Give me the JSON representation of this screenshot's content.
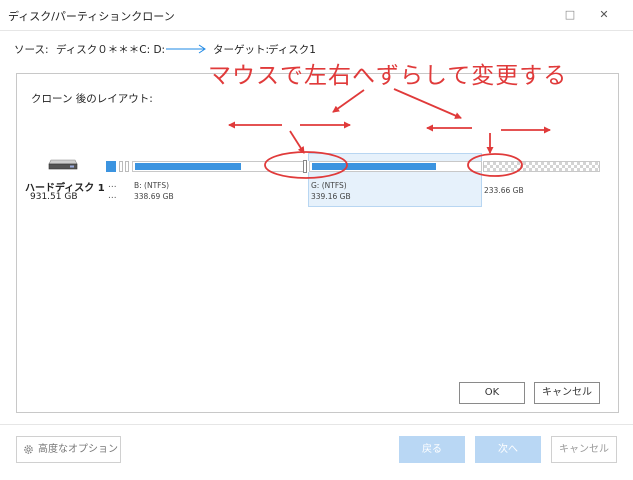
{
  "window": {
    "title": "ディスク/パーティションクローン",
    "minimize_glyph": "□",
    "close_glyph": "✕"
  },
  "route": {
    "source_label": "ソース:",
    "source_value": "ディスク０＊＊＊C: D:",
    "target_label": "ターゲット:",
    "target_value": "ディスク1"
  },
  "annotation": {
    "text": "マウスで左右へずらして変更する",
    "color": "#e03a3a"
  },
  "layout": {
    "label": "クローン 後のレイアウト:"
  },
  "disk": {
    "name": "ハードディスク 1",
    "size": "931.51 GB",
    "dots": "...",
    "icon": "hard-disk-icon"
  },
  "partitions": {
    "b": {
      "name": "B: (NTFS)",
      "size": "338.69 GB"
    },
    "g": {
      "name": "G: (NTFS)",
      "size": "339.16 GB"
    },
    "free": {
      "size": "233.66 GB"
    }
  },
  "dialog": {
    "ok": "OK",
    "cancel": "キャンセル"
  },
  "footer": {
    "advanced": "高度なオプション",
    "back": "戻る",
    "next": "次へ",
    "cancel": "キャンセル"
  },
  "colors": {
    "accent": "#1e88e5",
    "bar_fill": "#3c94e0",
    "selected_bg": "#e6f1fb",
    "disabled_button": "#b9d7f4"
  }
}
